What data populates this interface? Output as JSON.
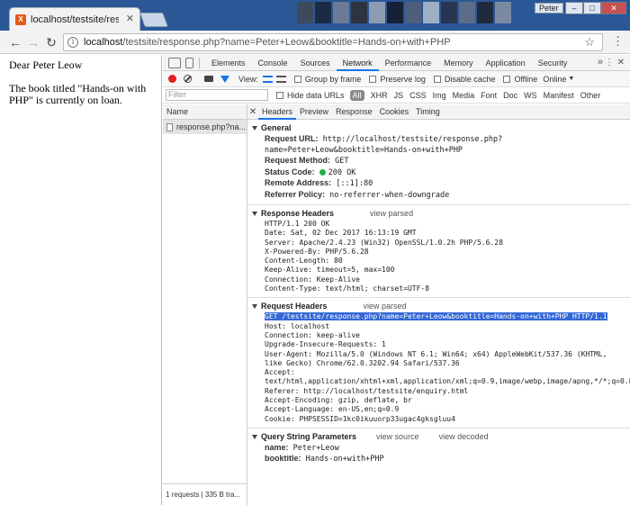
{
  "browser": {
    "tab_title": "localhost/testsite/respon",
    "favicon_text": "X",
    "user": "Peter",
    "win_min": "–",
    "win_max": "□",
    "win_close": "✕",
    "url_host": "localhost",
    "url_rest": "/testsite/response.php?name=Peter+Leow&booktitle=Hands-on+with+PHP"
  },
  "page": {
    "greeting": "Dear Peter Leow",
    "message": "The book titled \"Hands-on with PHP\" is currently on loan."
  },
  "devtools": {
    "tabs": [
      "Elements",
      "Console",
      "Sources",
      "Network",
      "Performance",
      "Memory",
      "Application",
      "Security"
    ],
    "active_tab": "Network",
    "toolbar": {
      "view_label": "View:",
      "group_by_frame": "Group by frame",
      "preserve_log": "Preserve log",
      "disable_cache": "Disable cache",
      "offline": "Offline",
      "online": "Online"
    },
    "filter": {
      "placeholder": "Filter",
      "hide_data_urls": "Hide data URLs",
      "all": "All",
      "types": [
        "XHR",
        "JS",
        "CSS",
        "Img",
        "Media",
        "Font",
        "Doc",
        "WS",
        "Manifest",
        "Other"
      ]
    },
    "name_column": {
      "header": "Name",
      "rows": [
        "response.php?na..."
      ],
      "status": "1 requests  |  335 B tra..."
    },
    "detail_tabs": [
      "Headers",
      "Preview",
      "Response",
      "Cookies",
      "Timing"
    ],
    "general": {
      "title": "General",
      "request_url_label": "Request URL:",
      "request_url": "http://localhost/testsite/response.php?name=Peter+Leow&booktitle=Hands-on+with+PHP",
      "request_method_label": "Request Method:",
      "request_method": "GET",
      "status_code_label": "Status Code:",
      "status_code": "200 OK",
      "remote_address_label": "Remote Address:",
      "remote_address": "[::1]:80",
      "referrer_policy_label": "Referrer Policy:",
      "referrer_policy": "no-referrer-when-downgrade"
    },
    "response_headers": {
      "title": "Response Headers",
      "view_parsed": "view parsed",
      "lines": [
        "HTTP/1.1 200 OK",
        "Date: Sat, 02 Dec 2017 16:13:19 GMT",
        "Server: Apache/2.4.23 (Win32) OpenSSL/1.0.2h PHP/5.6.28",
        "X-Powered-By: PHP/5.6.28",
        "Content-Length: 80",
        "Keep-Alive: timeout=5, max=100",
        "Connection: Keep-Alive",
        "Content-Type: text/html; charset=UTF-8"
      ]
    },
    "request_headers": {
      "title": "Request Headers",
      "view_parsed": "view parsed",
      "first_line": "GET /testsite/response.php?name=Peter+Leow&booktitle=Hands-on+with+PHP HTTP/1.1",
      "lines": [
        "Host: localhost",
        "Connection: keep-alive",
        "Upgrade-Insecure-Requests: 1"
      ],
      "user_agent": "User-Agent: Mozilla/5.0 (Windows NT 6.1; Win64; x64) AppleWebKit/537.36 (KHTML, like Gecko) Chrome/62.0.3202.94 Safari/537.36",
      "accept": "Accept: text/html,application/xhtml+xml,application/xml;q=0.9,image/webp,image/apng,*/*;q=0.8",
      "lines2": [
        "Referer: http://localhost/testsite/enquiry.html",
        "Accept-Encoding: gzip, deflate, br",
        "Accept-Language: en-US,en;q=0.9",
        "Cookie: PHPSESSID=1kc0ikuuorp33ugac4gksgluu4"
      ]
    },
    "query_string": {
      "title": "Query String Parameters",
      "view_source": "view source",
      "view_decoded": "view decoded",
      "name_label": "name:",
      "name": "Peter+Leow",
      "booktitle_label": "booktitle:",
      "booktitle": "Hands-on+with+PHP"
    }
  }
}
